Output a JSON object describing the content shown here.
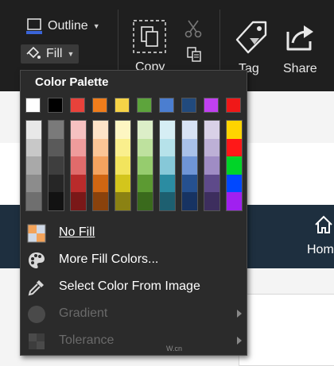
{
  "ribbon": {
    "outline_label": "Outline",
    "fill_label": "Fill",
    "copy_label": "Copy",
    "tag_label": "Tag",
    "share_label": "Share"
  },
  "background": {
    "nav_label": "Hom"
  },
  "menu": {
    "title": "Color Palette",
    "top_swatches": [
      "#ffffff",
      "#000000",
      "#e8423b",
      "#f07d1b",
      "#f6d347",
      "#5da43c",
      "#4b7ed0",
      "#214a7d",
      "#c040f0",
      "#f01818"
    ],
    "columns": [
      [
        "#e8e8e8",
        "#c8c8c8",
        "#a9a9a9",
        "#8c8c8c",
        "#6f6f6f"
      ],
      [
        "#7a7a7a",
        "#5a5a5a",
        "#3e3e3e",
        "#262626",
        "#121212"
      ],
      [
        "#f6c1c1",
        "#ef9c9c",
        "#e06b6b",
        "#b92b2b",
        "#7a1818"
      ],
      [
        "#fde3c8",
        "#fbc596",
        "#f4a35f",
        "#d06612",
        "#8a420c"
      ],
      [
        "#fdf6c2",
        "#faef8d",
        "#f2e45d",
        "#d3c51c",
        "#8b8213"
      ],
      [
        "#dceec8",
        "#bee19e",
        "#96cc6e",
        "#5c9a32",
        "#3a6a1c"
      ],
      [
        "#d6eef4",
        "#b6e2ea",
        "#86c8d8",
        "#2b8ca2",
        "#1d5f70"
      ],
      [
        "#d7e2f4",
        "#a9c1e9",
        "#6f95d6",
        "#25508f",
        "#173362"
      ],
      [
        "#d9d1e7",
        "#bdb0d6",
        "#9f8cc4",
        "#5e4a8a",
        "#3d2e5e"
      ],
      [
        "#ffd400",
        "#ff1818",
        "#00d428",
        "#0048ff",
        "#a020f0"
      ]
    ],
    "items": [
      {
        "label": "No Fill",
        "icon": "no-fill-icon",
        "enabled": true
      },
      {
        "label": "More Fill Colors...",
        "icon": "palette-icon",
        "enabled": true
      },
      {
        "label": "Select Color From Image",
        "icon": "eyedropper-icon",
        "enabled": true
      },
      {
        "label": "Gradient",
        "icon": "gradient-icon",
        "enabled": false
      },
      {
        "label": "Tolerance",
        "icon": "tolerance-icon",
        "enabled": false
      }
    ],
    "watermark": "W.cn"
  },
  "colors": {
    "ribbon_bg": "#1f1f1f",
    "menu_bg": "#2b2b2b",
    "nav_bg": "#1e2f3f"
  }
}
